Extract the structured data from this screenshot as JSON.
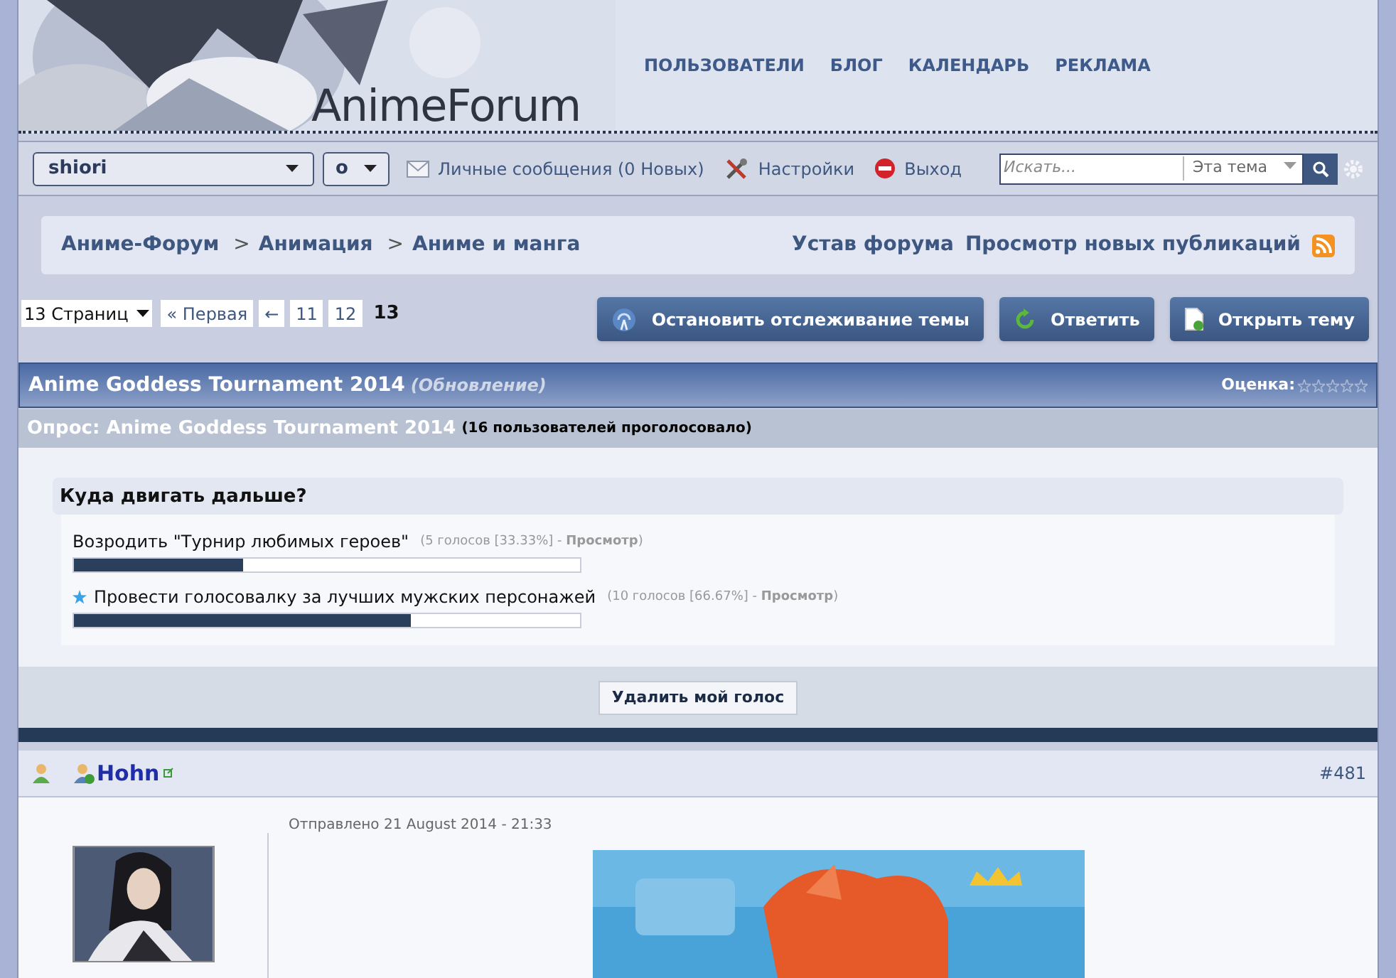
{
  "header": {
    "logo": "AnimeForum",
    "nav": [
      "ПОЛЬЗОВАТЕЛИ",
      "БЛОГ",
      "КАЛЕНДАРЬ",
      "РЕКЛАМА"
    ]
  },
  "toolbar": {
    "user": "shiori",
    "status": "o",
    "links": [
      {
        "label": "Личные сообщения (0 Новых)",
        "kind": "mail"
      },
      {
        "label": "Настройки",
        "kind": "tools"
      },
      {
        "label": "Выход",
        "kind": "exit"
      }
    ],
    "search": {
      "placeholder": "Искать...",
      "scope": "Эта тема"
    }
  },
  "breadcrumbs": {
    "separator": ">",
    "items": [
      "Аниме-Форум",
      "Анимация",
      "Аниме и манга"
    ]
  },
  "forum_links": [
    "Устав форума",
    "Просмотр новых публикаций"
  ],
  "pagination": {
    "pages_menu": "13 Страниц",
    "first": "« Первая",
    "prev": "←",
    "pages": [
      {
        "label": "11",
        "selected": false
      },
      {
        "label": "12",
        "selected": false
      },
      {
        "label": "13",
        "selected": true
      }
    ]
  },
  "topic_buttons": [
    {
      "label": "Остановить отслеживание темы",
      "kind": "track"
    },
    {
      "label": "Ответить",
      "kind": "reply"
    },
    {
      "label": "Открыть тему",
      "kind": "open"
    }
  ],
  "topic": {
    "title": "Anime Goddess Tournament 2014",
    "note": "(Обновление)",
    "rating_label": "Оценка:",
    "stars": 0
  },
  "poll": {
    "title": "Опрос: Anime Goddess Tournament 2014",
    "votes_note": "(16 пользователей проголосовало)",
    "question": "Куда двигать дальше?",
    "options": [
      {
        "label": "Возродить \"Турнир любимых героев\"",
        "stats": "(5 голосов [33.33%] - **Просмотр**)",
        "level": 0.3333,
        "voted": false
      },
      {
        "label": "Провести голосовалку за лучших мужских персонажей",
        "stats": "(10 голосов [66.67%] - **Просмотр**)",
        "level": 0.6667,
        "voted": true
      }
    ],
    "delete_vote": "Удалить мой голос"
  },
  "post": {
    "author": "Hohn",
    "number": "#481",
    "posted": "Отправлено 21 August 2014 - 21:33"
  }
}
